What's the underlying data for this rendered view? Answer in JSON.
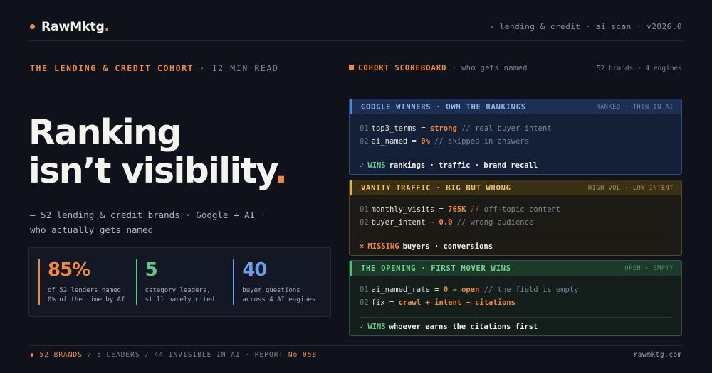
{
  "brand": {
    "name": "RawMktg",
    "period": "."
  },
  "header": {
    "meta": "› lending & credit · ai scan · v2026.0"
  },
  "kicker": {
    "title": "THE LENDING & CREDIT COHORT",
    "sep": "·",
    "read": "12 MIN READ"
  },
  "headline": {
    "line1": "Ranking",
    "line2": "isn’t visibility",
    "period": "."
  },
  "subline": {
    "line1": "— 52 lending & credit brands · Google + AI ·",
    "line2": "who actually gets named"
  },
  "stats": [
    {
      "value": "85%",
      "line1": "of 52 lenders named",
      "line2": "0% of the time by AI",
      "color": "#f08a3e"
    },
    {
      "value": "5",
      "line1": "category leaders,",
      "line2": "still barely cited",
      "color": "#5fc98a"
    },
    {
      "value": "40",
      "line1": "buyer questions",
      "line2": "across 4 AI engines",
      "color": "#6b9fe8"
    }
  ],
  "scoreboard": {
    "title": "COHORT SCOREBOARD",
    "subtitle": "· who gets named",
    "meta": "52 brands · 4 engines"
  },
  "cards": [
    {
      "title": "GOOGLE WINNERS · OWN THE RANKINGS",
      "tag": "RANKED · THIN IN AI",
      "l1": {
        "n": "01",
        "key": "top3_terms",
        "op": " = ",
        "val": "strong",
        "cm": " // real buyer intent"
      },
      "l2": {
        "n": "02",
        "key": "ai_named",
        "op": " = ",
        "val": "0%",
        "cm": " // skipped in answers"
      },
      "foot": {
        "mark": "✓",
        "label": "WINS",
        "text": "rankings · traffic · brand recall"
      }
    },
    {
      "title": "VANITY TRAFFIC · BIG BUT WRONG",
      "tag": "HIGH VOL · LOW INTENT",
      "l1": {
        "n": "01",
        "key": "monthly_visits",
        "op": " = ",
        "val": "765K",
        "cm": " // off-topic content"
      },
      "l2": {
        "n": "02",
        "key": "buyer_intent",
        "op": " ~ ",
        "val": "0.0",
        "cm": " // wrong audience"
      },
      "foot": {
        "mark": "×",
        "label": "MISSING",
        "text": "buyers · conversions"
      }
    },
    {
      "title": "THE OPENING · FIRST MOVER WINS",
      "tag": "OPEN · EMPTY",
      "l1": {
        "n": "01",
        "key": "ai_named_rate",
        "op": " = ",
        "val": "0 → open",
        "cm": " // the field is empty"
      },
      "l2": {
        "n": "02",
        "key": "fix",
        "op": " = ",
        "val": "crawl + intent + citations",
        "cm": ""
      },
      "foot": {
        "mark": "✓",
        "label": "WINS",
        "text": "whoever earns the citations first"
      }
    }
  ],
  "footer": {
    "a": "◆ 52 BRANDS",
    "b": " / 5 LEADERS / 44 INVISIBLE IN AI · REPORT ",
    "c": "No 058",
    "site": "rawmktg.com"
  }
}
